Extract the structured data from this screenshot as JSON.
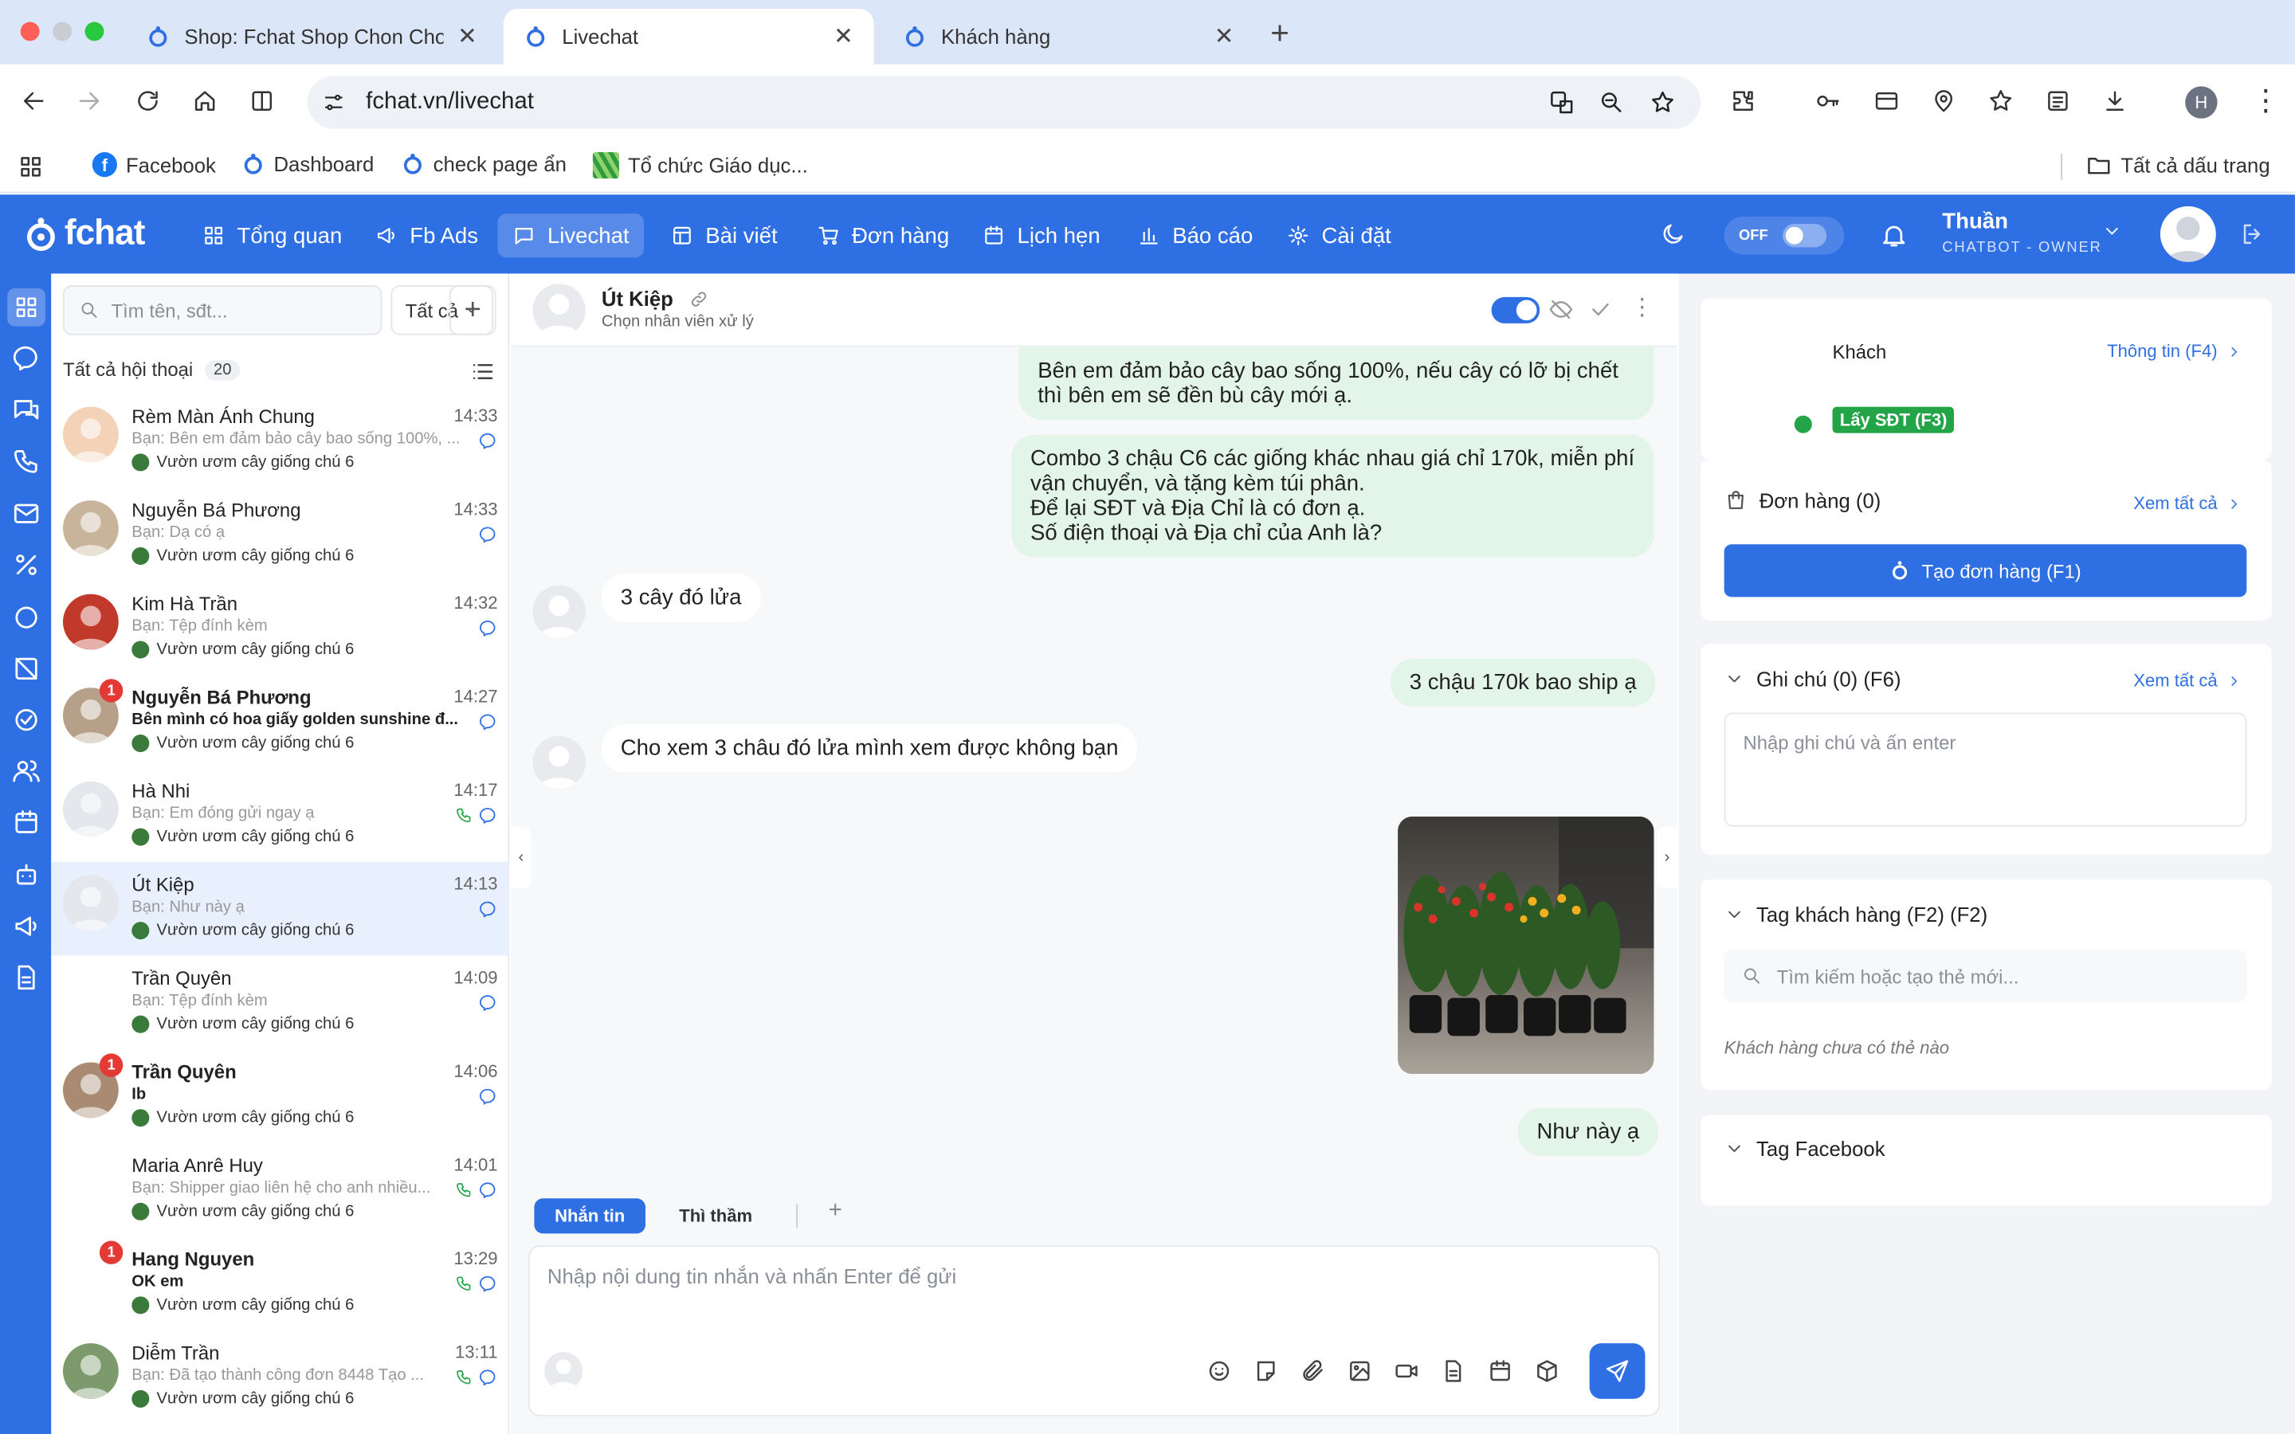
{
  "browser": {
    "tabs": [
      {
        "title": "Shop: Fchat Shop Chon Chon"
      },
      {
        "title": "Livechat"
      },
      {
        "title": "Khách hàng"
      }
    ],
    "url": "fchat.vn/livechat",
    "profile_initial": "H",
    "bookmarks": [
      {
        "label": "Facebook"
      },
      {
        "label": "Dashboard"
      },
      {
        "label": "check page ẩn"
      },
      {
        "label": "Tổ chức Giáo dục..."
      }
    ],
    "all_bookmarks": "Tất cả dấu trang"
  },
  "app": {
    "logo": "fchat",
    "nav": [
      {
        "label": "Tổng quan"
      },
      {
        "label": "Fb Ads"
      },
      {
        "label": "Livechat"
      },
      {
        "label": "Bài viết"
      },
      {
        "label": "Đơn hàng"
      },
      {
        "label": "Lịch hẹn"
      },
      {
        "label": "Báo cáo"
      },
      {
        "label": "Cài đặt"
      }
    ],
    "toggle_label": "OFF",
    "user_name": "Thuần",
    "user_role": "CHATBOT - OWNER",
    "accent": "#2f6fe4"
  },
  "conversations": {
    "search_placeholder": "Tìm tên, sđt...",
    "filter": "Tất cả",
    "header": "Tất cả hội thoại",
    "count": "20",
    "items": [
      {
        "name": "Rèm Màn Ánh Chung",
        "time": "14:33",
        "msg": "Bạn: Bên em đảm bảo cây bao sống 100%, ...",
        "page": "Vườn ươm cây giống chú 6"
      },
      {
        "name": "Nguyễn Bá Phương",
        "time": "14:33",
        "msg": "Bạn: Dạ có ạ",
        "page": "Vườn ươm cây giống chú 6"
      },
      {
        "name": "Kim Hà Trần",
        "time": "14:32",
        "msg": "Bạn: Tệp đính kèm",
        "page": "Vườn ươm cây giống chú 6"
      },
      {
        "name": "Nguyễn Bá Phương",
        "time": "14:27",
        "msg": "Bên mình có hoa giấy golden sunshine đ...",
        "page": "Vườn ươm cây giống chú 6",
        "badge": "1"
      },
      {
        "name": "Hà Nhi",
        "time": "14:17",
        "msg": "Bạn: Em đóng gửi ngay ạ",
        "page": "Vườn ươm cây giống chú 6"
      },
      {
        "name": "Út Kiệp",
        "time": "14:13",
        "msg": "Bạn: Như này ạ",
        "page": "Vườn ươm cây giống chú 6"
      },
      {
        "name": "Trần Quyên",
        "time": "14:09",
        "msg": "Bạn: Tệp đính kèm",
        "page": "Vườn ươm cây giống chú 6"
      },
      {
        "name": "Trần Quyên",
        "time": "14:06",
        "msg": "Ib",
        "page": "Vườn ươm cây giống chú 6",
        "badge": "1"
      },
      {
        "name": "Maria Anrê Huy",
        "time": "14:01",
        "msg": "Bạn: Shipper giao liên hệ cho anh nhiều...",
        "page": "Vườn ươm cây giống chú 6"
      },
      {
        "name": "Hang Nguyen",
        "time": "13:29",
        "msg": "OK em",
        "page": "Vườn ươm cây giống chú 6",
        "badge": "1"
      },
      {
        "name": "Diễm Trần",
        "time": "13:11",
        "msg": "Bạn: Đã tạo thành công đơn 8448 Tạo ...",
        "page": "Vườn ươm cây giống chú 6"
      }
    ]
  },
  "chat": {
    "contact_name": "Út Kiệp",
    "assign_hint": "Chọn nhân viên xử lý",
    "messages": [
      {
        "dir": "out",
        "text": "Bên em đảm bảo cây bao sống 100%, nếu cây có lỡ bị chết\nthì bên em sẽ đền bù cây mới ạ."
      },
      {
        "dir": "out",
        "text": "Combo 3 chậu C6 các giống khác nhau giá chỉ 170k, miễn phí\nvận chuyển, và tặng kèm túi phân.\nĐể lại SĐT và Địa Chỉ là có đơn ạ.\nSố điện thoại và Địa chỉ của Anh là?"
      },
      {
        "dir": "in",
        "text": "3 cây đó lửa"
      },
      {
        "dir": "out",
        "text": "3 chậu 170k bao ship ạ"
      },
      {
        "dir": "in",
        "text": "Cho xem 3 châu đó lửa mình xem được không bạn"
      },
      {
        "dir": "out",
        "text": "Như này ạ"
      }
    ],
    "composer": {
      "tab_message": "Nhắn tin",
      "tab_whisper": "Thì thầm",
      "placeholder": "Nhập nội dung tin nhắn và nhấn Enter để gửi"
    }
  },
  "customer_panel": {
    "label": "Khách",
    "info_link": "Thông tin (F4)",
    "get_phone": "Lấy SĐT (F3)",
    "orders_title": "Đơn hàng (0)",
    "see_all": "Xem tất cả",
    "create_order": "Tạo đơn hàng (F1)",
    "notes_title": "Ghi chú (0) (F6)",
    "notes_placeholder": "Nhập ghi chú và ấn enter",
    "tags_title": "Tag khách hàng (F2) (F2)",
    "tag_search_placeholder": "Tìm kiếm hoặc tạo thẻ mới...",
    "no_tags": "Khách hàng chưa có thẻ nào",
    "fb_tags_title": "Tag Facebook"
  }
}
